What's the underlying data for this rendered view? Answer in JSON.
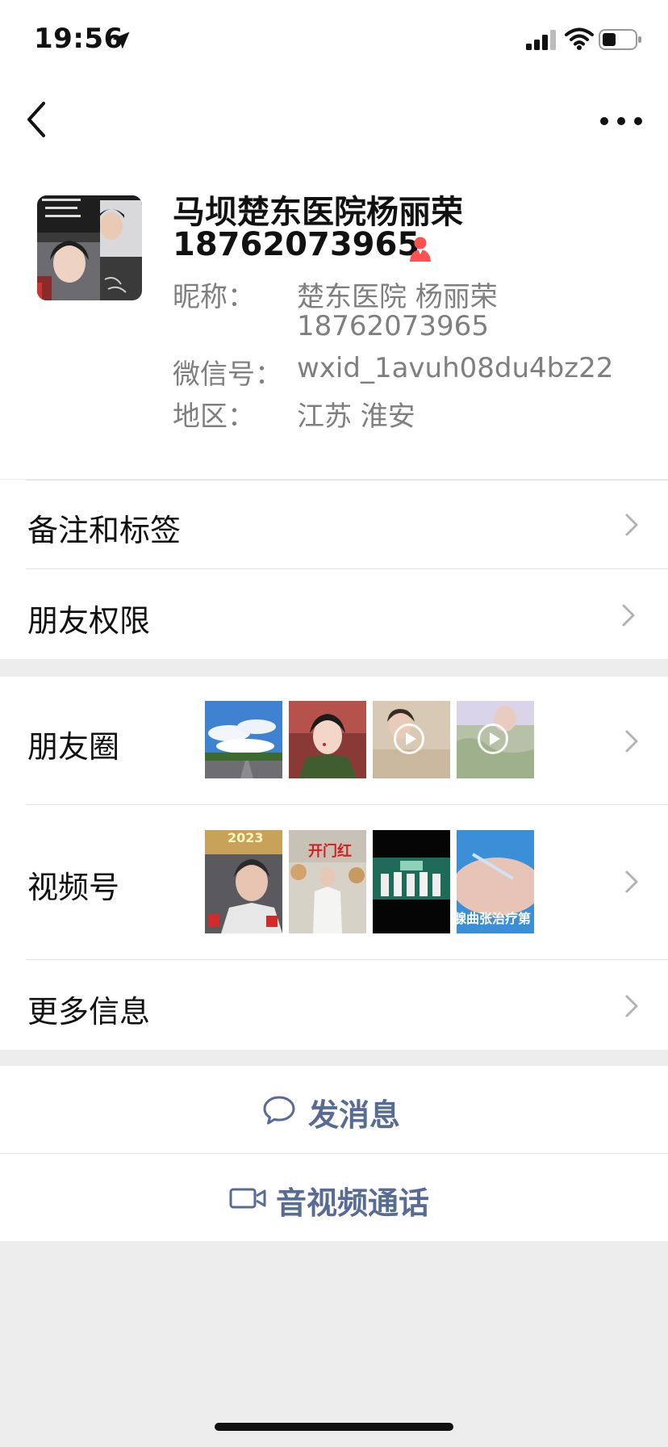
{
  "status_bar": {
    "time": "19:56",
    "icons": [
      "location-arrow-icon",
      "cellular-signal-icon",
      "wifi-icon",
      "battery-icon"
    ]
  },
  "nav": {
    "back_icon": "chevron-left-icon",
    "more_icon": "ellipsis-icon"
  },
  "profile": {
    "name_line1": "马坝楚东医院杨丽荣",
    "name_line2": "18762073965",
    "gender_icon": "female-icon",
    "nickname_label": "昵称：",
    "nickname_value_line1": "楚东医院 杨丽荣",
    "nickname_value_line2": "18762073965",
    "wechat_id_label": "微信号：",
    "wechat_id_value": "wxid_1avuh08du4bz22",
    "region_label": "地区：",
    "region_value": "江苏 淮安"
  },
  "rows": {
    "remarks_tags": "备注和标签",
    "friend_permissions": "朋友权限",
    "moments": "朋友圈",
    "channels": "视频号",
    "more_info": "更多信息"
  },
  "channels_thumbs": {
    "thumb1_text": "2023",
    "thumb2_text": "开门红",
    "thumb4_text": "腺曲张治疗第"
  },
  "actions": {
    "send_message": "发消息",
    "video_call": "音视频通话"
  },
  "colors": {
    "accent": "#576b95",
    "background": "#ededed",
    "gender_female": "#fa5151"
  }
}
